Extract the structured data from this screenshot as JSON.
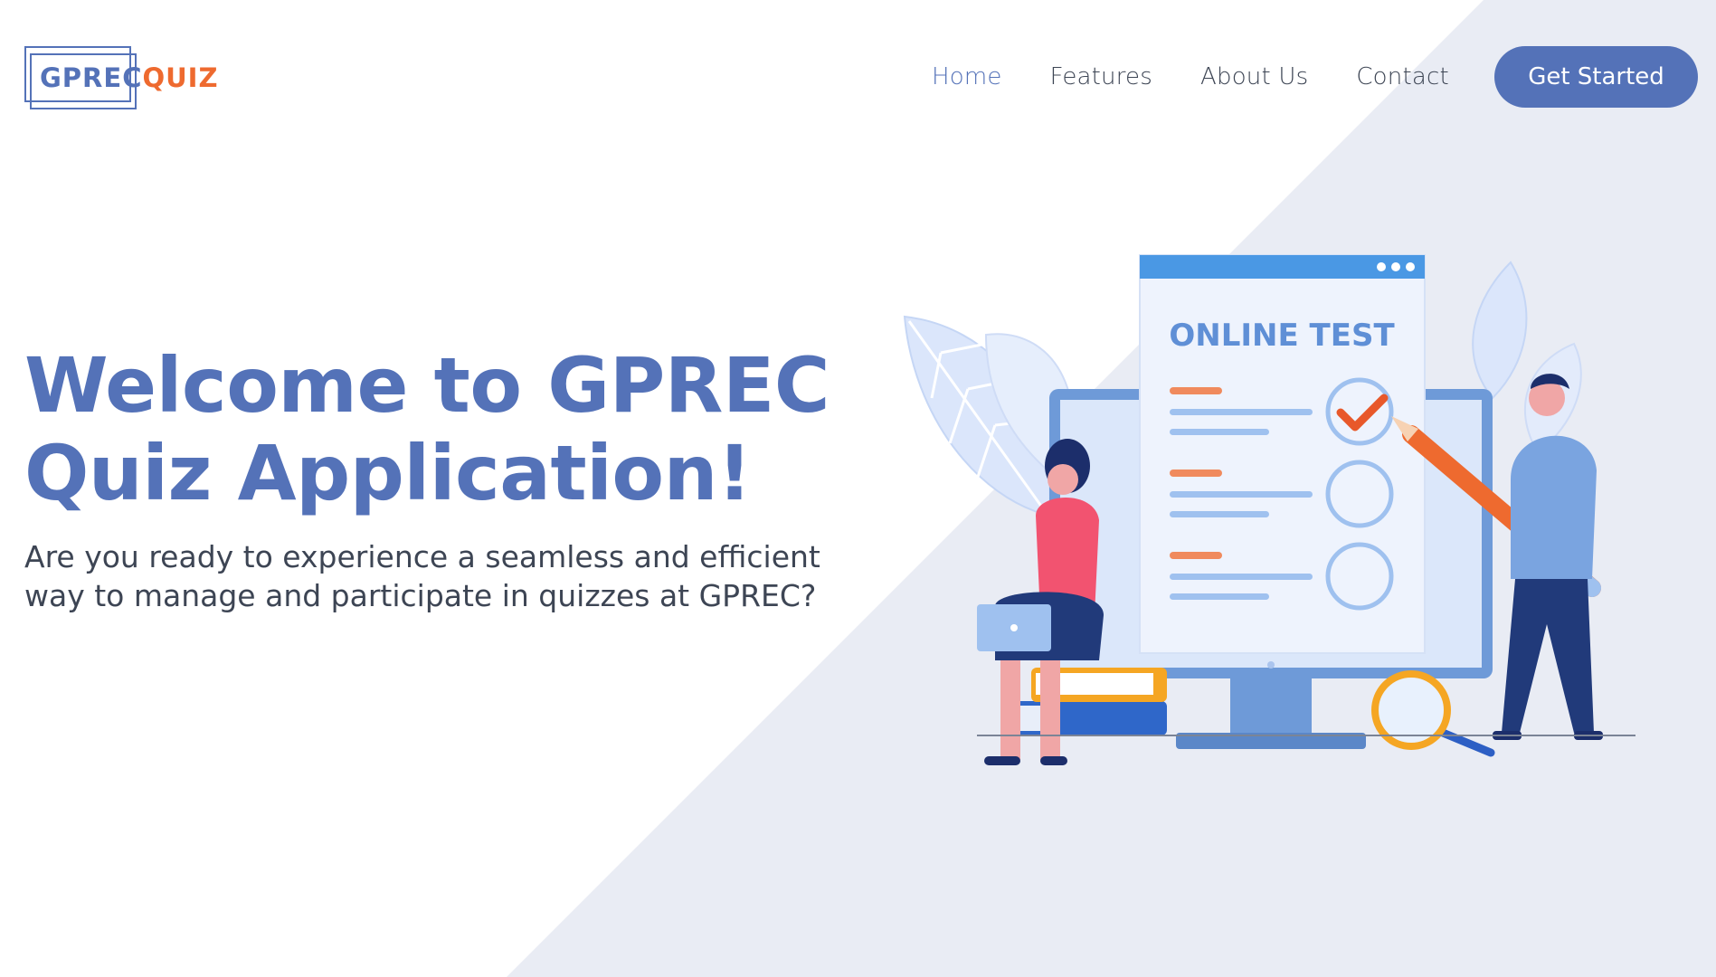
{
  "brand": {
    "logo_part1": "GPREC",
    "logo_part2": "QUIZ",
    "primary_color": "#5472b8",
    "accent_color": "#ee6a2f"
  },
  "nav": {
    "items": [
      {
        "label": "Home",
        "active": true
      },
      {
        "label": "Features",
        "active": false
      },
      {
        "label": "About Us",
        "active": false
      },
      {
        "label": "Contact",
        "active": false
      }
    ],
    "cta_label": "Get Started"
  },
  "hero": {
    "title_line1": "Welcome to GPREC",
    "title_line2": "Quiz Application!",
    "subtitle_line1": "Are you ready to experience a seamless and efficient",
    "subtitle_line2": "way to manage and participate in quizzes at GPREC?"
  },
  "illustration": {
    "screen_heading": "ONLINE TEST",
    "icons": [
      "monitor-icon",
      "checkmark-icon",
      "pencil-icon",
      "magnifier-icon",
      "laptop-icon",
      "books-icon",
      "leaf-icon"
    ]
  }
}
